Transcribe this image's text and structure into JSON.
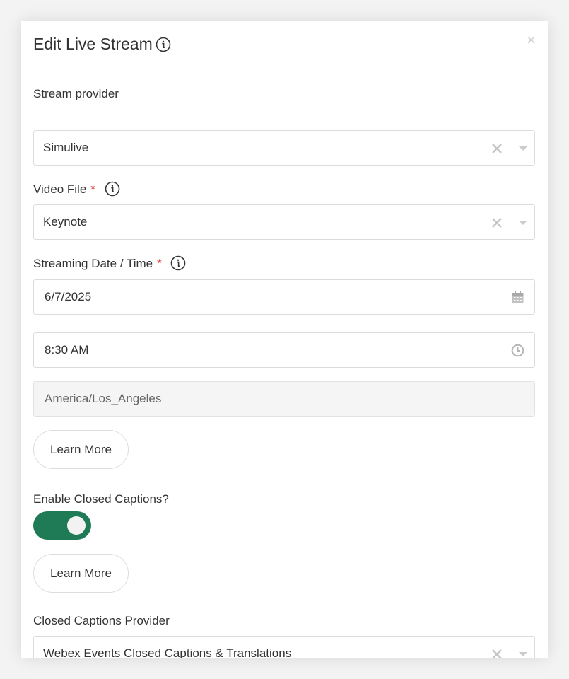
{
  "modal": {
    "title": "Edit Live Stream",
    "close_glyph": "×"
  },
  "fields": {
    "stream_provider": {
      "label": "Stream provider",
      "value": "Simulive"
    },
    "video_file": {
      "label": "Video File",
      "required_mark": "*",
      "value": "Keynote"
    },
    "streaming_datetime": {
      "label": "Streaming Date / Time",
      "required_mark": "*",
      "date": "6/7/2025",
      "time": "8:30 AM",
      "timezone": "America/Los_Angeles"
    },
    "learn_more_1": "Learn More",
    "closed_captions": {
      "label": "Enable Closed Captions?",
      "enabled": true
    },
    "learn_more_2": "Learn More",
    "captions_provider": {
      "label": "Closed Captions Provider",
      "value": "Webex Events Closed Captions & Translations"
    }
  },
  "icons": {
    "info": "info-icon",
    "close": "close-icon",
    "clear": "clear-icon",
    "dropdown": "chevron-down-icon",
    "calendar": "calendar-icon",
    "clock": "clock-icon"
  },
  "colors": {
    "toggle_on": "#1f7a56",
    "required": "#e0463f",
    "border": "#dcdcdc",
    "readonly_bg": "#f5f5f5"
  }
}
